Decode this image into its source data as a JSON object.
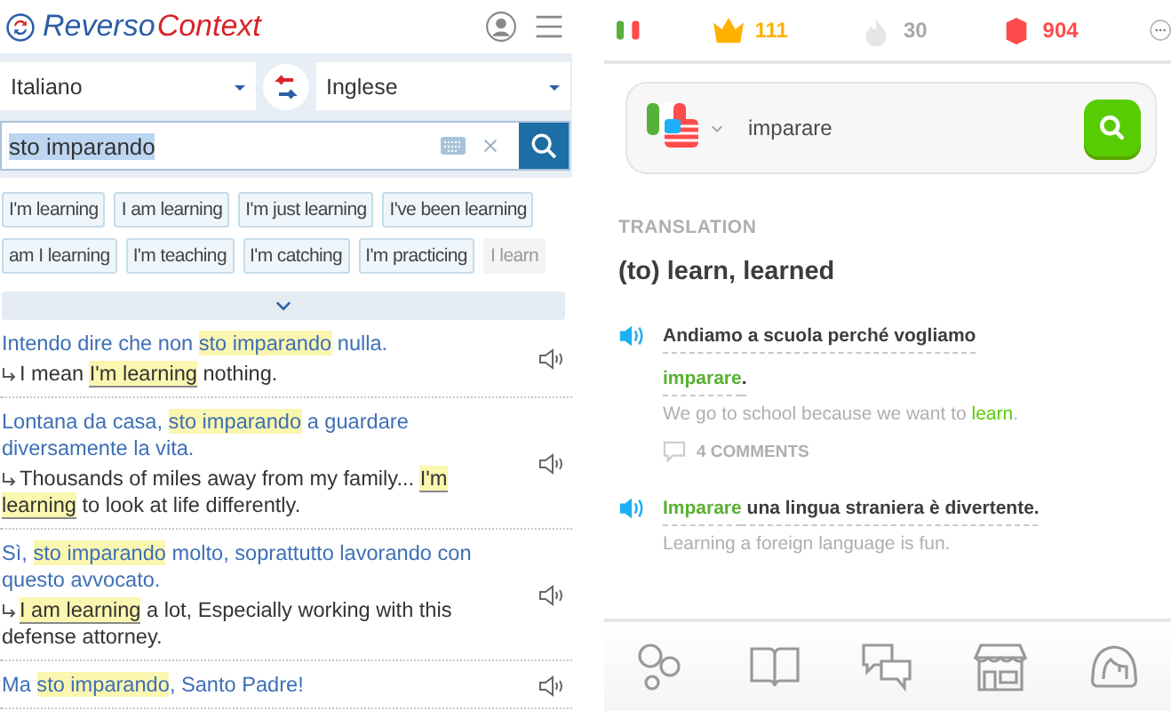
{
  "reverso": {
    "logo": {
      "first": "Reverso",
      "second": "Context"
    },
    "source_language": "Italiano",
    "target_language": "Inglese",
    "query": {
      "value": "sto imparando",
      "selected": true
    },
    "suggestions": [
      {
        "text": "I'm learning",
        "frequent": true
      },
      {
        "text": "I am learning",
        "frequent": true
      },
      {
        "text": "I'm just learning",
        "frequent": true
      },
      {
        "text": "I've been learning",
        "frequent": true
      },
      {
        "text": "am I learning",
        "frequent": true
      },
      {
        "text": "I'm teaching",
        "frequent": true
      },
      {
        "text": "I'm catching",
        "frequent": true
      },
      {
        "text": "I'm practicing",
        "frequent": true
      },
      {
        "text": "I learn",
        "frequent": false
      }
    ],
    "examples": [
      {
        "source": "Intendo dire che non **sto imparando** nulla.",
        "target": "I mean **I'm learning** nothing."
      },
      {
        "source": "Lontana da casa, **sto imparando** a guardare diversamente la vita.",
        "target": "Thousands of miles away from my family... **I'm learning** to look at life differently."
      },
      {
        "source": "Sì, **sto imparando** molto, soprattutto lavorando con questo avvocato.",
        "target": "**I am learning** a lot, Especially working with this defense attorney."
      },
      {
        "source": "Ma **sto imparando**, Santo Padre!"
      }
    ]
  },
  "duolingo": {
    "stats": [
      {
        "kind": "crowns",
        "value": "111",
        "active": true
      },
      {
        "kind": "streak",
        "value": "30",
        "active": false
      },
      {
        "kind": "gems",
        "value": "904",
        "active": true
      }
    ],
    "search": {
      "value": "imparare"
    },
    "section_label": "TRANSLATION",
    "translation": "(to) learn, learned",
    "examples": [
      {
        "sentence": "Andiamo a scuola perché vogliamo **imparare**.",
        "translation": "We go to school because we want to **learn**.",
        "comments": "4 COMMENTS"
      },
      {
        "sentence": "**Imparare** una lingua straniera è divertente.",
        "translation": "Learning a foreign language is fun."
      }
    ],
    "nav": [
      {
        "kind": "bubbles"
      },
      {
        "kind": "book"
      },
      {
        "kind": "chat"
      },
      {
        "kind": "shop"
      },
      {
        "kind": "profile"
      }
    ]
  }
}
